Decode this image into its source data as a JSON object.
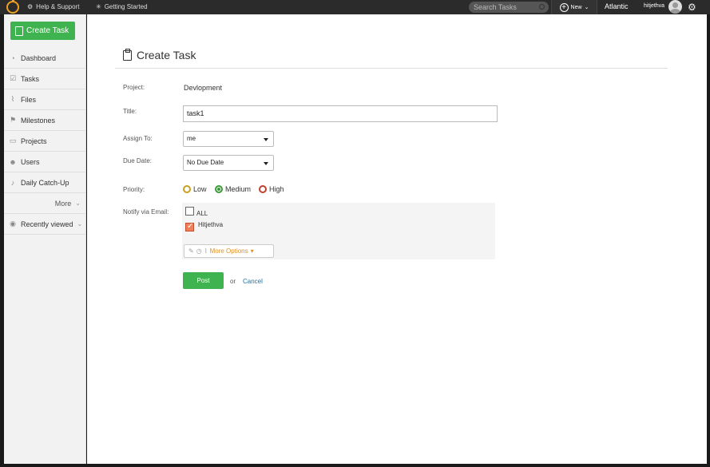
{
  "topbar": {
    "help_label": "Help & Support",
    "getting_started_label": "Getting Started",
    "search_placeholder": "Search Tasks",
    "new_label": "New",
    "org_name": "Atlantic",
    "username": "hitjethva"
  },
  "sidebar": {
    "create_task_label": "Create Task",
    "items": [
      {
        "label": "Dashboard",
        "icon": "gauge-icon"
      },
      {
        "label": "Tasks",
        "icon": "checklist-icon"
      },
      {
        "label": "Files",
        "icon": "paperclip-icon"
      },
      {
        "label": "Milestones",
        "icon": "milestone-icon"
      },
      {
        "label": "Projects",
        "icon": "folder-icon"
      },
      {
        "label": "Users",
        "icon": "users-icon"
      },
      {
        "label": "Daily Catch-Up",
        "icon": "bell-icon"
      }
    ],
    "more_label": "More",
    "recently_viewed_label": "Recently viewed"
  },
  "form": {
    "page_title": "Create Task",
    "project_label": "Project:",
    "project_value": "Devlopment",
    "title_label": "Title:",
    "title_value": "task1",
    "assign_label": "Assign To:",
    "assign_value": "me",
    "due_label": "Due Date:",
    "due_value": "No Due Date",
    "priority_label": "Priority:",
    "priority_options": [
      "Low",
      "Medium",
      "High"
    ],
    "priority_selected": "Medium",
    "notify_label": "Notify via Email:",
    "notify_all_label": "ALL",
    "notify_user_label": "Hitjethva",
    "more_options_label": "More Options",
    "post_label": "Post",
    "or_label": "or",
    "cancel_label": "Cancel"
  },
  "colors": {
    "accent_green": "#3fb34f",
    "low": "#c8a020",
    "medium": "#3a9a3a",
    "high": "#c04030",
    "link": "#1a73a8"
  }
}
